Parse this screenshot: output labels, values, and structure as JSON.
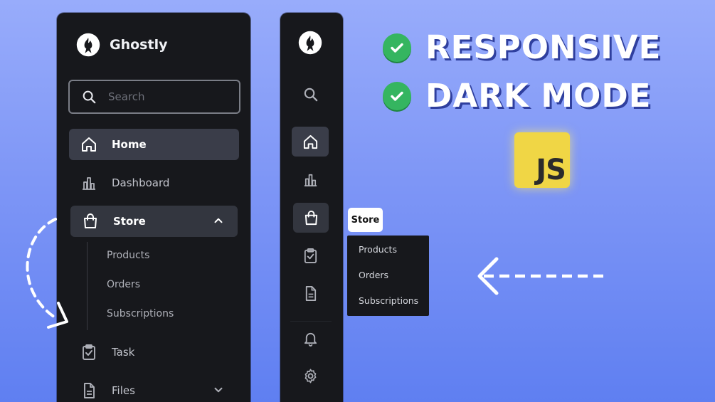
{
  "sidebar": {
    "brand_name": "Ghostly",
    "search_placeholder": "Search",
    "items": [
      {
        "label": "Home"
      },
      {
        "label": "Dashboard"
      },
      {
        "label": "Store"
      },
      {
        "label": "Task"
      },
      {
        "label": "Files"
      }
    ],
    "store_submenu": [
      "Products",
      "Orders",
      "Subscriptions"
    ]
  },
  "mini_sidebar": {
    "tooltip": "Store",
    "flyout": [
      "Products",
      "Orders",
      "Subscriptions"
    ]
  },
  "headline": {
    "features": [
      "RESPONSIVE",
      "DARK MODE"
    ],
    "badge": "JS"
  },
  "icons": {
    "logo": "ghost-flame-logo",
    "search": "search-icon",
    "home": "home-icon",
    "dashboard": "bar-chart-icon",
    "store": "shopping-bag-icon",
    "task": "clipboard-check-icon",
    "files": "file-icon",
    "notifications": "bell-icon",
    "settings": "gear-icon",
    "feature_check": "check-circle-icon"
  },
  "colors": {
    "panel": "#17181c",
    "active_item": "#3a3d49",
    "check_green": "#35b560",
    "js_yellow": "#f0d645"
  }
}
